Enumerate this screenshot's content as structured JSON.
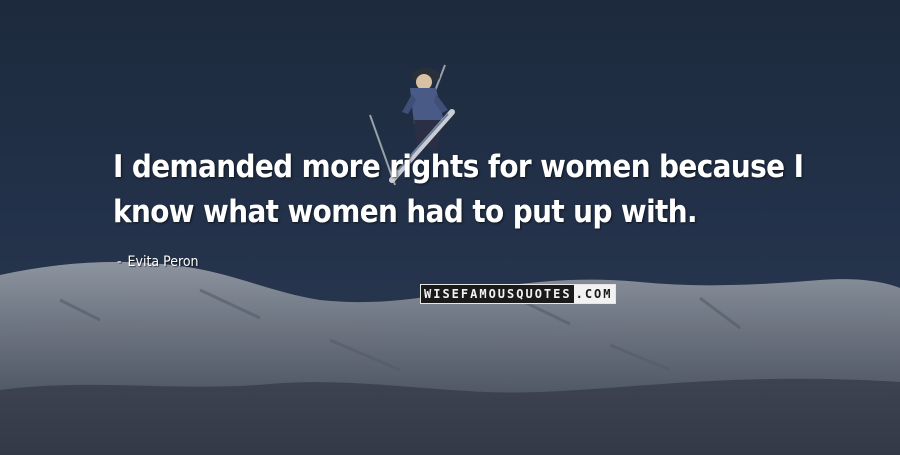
{
  "quote": {
    "text": "I demanded more rights for women because I know what women had to put up with.",
    "author_dash": "-",
    "author": "Evita Peron"
  },
  "logo": {
    "main": "WISEFAMOUSQUOTES",
    "tld": ".COM"
  },
  "image": {
    "subject_icon": "skier-icon",
    "background": "snowy-mountain-icon"
  }
}
